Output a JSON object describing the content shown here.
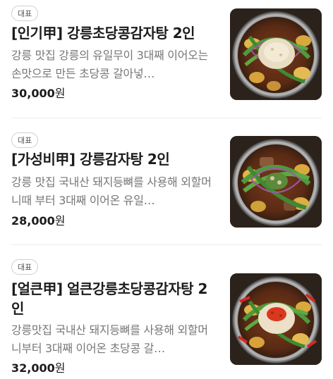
{
  "menu": {
    "items": [
      {
        "badge": "대표",
        "title": "[인기甲] 강릉초당콩감자탕 2인",
        "description": "강릉 맛집 강릉의 유일무이 3대째 이어오는 손맛으로 만든 초당콩 갈아넣…",
        "price": "30,000",
        "currency": "원",
        "image_icon": "gamjatang-soybean-photo"
      },
      {
        "badge": "대표",
        "title": "[가성비甲] 강릉감자탕 2인",
        "description": "강릉 맛집 국내산 돼지등뼈를 사용해 외할머니때 부터 3대째 이어온 유일…",
        "price": "28,000",
        "currency": "원",
        "image_icon": "gamjatang-photo"
      },
      {
        "badge": "대표",
        "title": "[얼큰甲] 얼큰강릉초당콩감자탕 2인",
        "description": "강릉맛집 국내산 돼지등뼈를 사용해 외할머니부터 3대째 이어온 초당콩 갈…",
        "price": "32,000",
        "currency": "원",
        "image_icon": "spicy-gamjatang-photo"
      }
    ]
  }
}
